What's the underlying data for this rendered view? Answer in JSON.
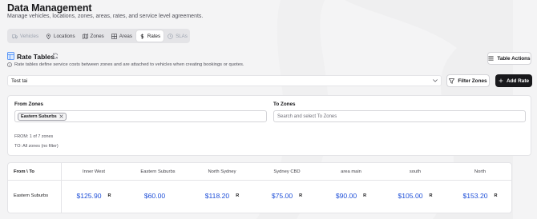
{
  "header": {
    "title": "Data Management",
    "subtitle": "Manage vehicles, locations, zones, areas, rates, and service level agreements."
  },
  "tabs": [
    {
      "label": "Vehicles",
      "icon": "truck-icon",
      "state": "muted"
    },
    {
      "label": "Locations",
      "icon": "map-pin-icon",
      "state": "normal"
    },
    {
      "label": "Zones",
      "icon": "map-icon",
      "state": "normal"
    },
    {
      "label": "Areas",
      "icon": "grid-icon",
      "state": "normal"
    },
    {
      "label": "Rates",
      "icon": "dollar-icon",
      "state": "active"
    },
    {
      "label": "SLAs",
      "icon": "clock-icon",
      "state": "muted"
    }
  ],
  "rate_tables": {
    "title": "Rate Tables",
    "description": "Rate tables define service costs between zones and are attached to vehicles when creating bookings or quotes.",
    "table_actions_label": "Table Actions",
    "selected_table": "Test tai",
    "filter_zones_label": "Filter Zones",
    "add_rate_label": "Add Rate"
  },
  "filters": {
    "from_label": "From Zones",
    "to_label": "To Zones",
    "from_chip": "Eastern Suburbs",
    "to_placeholder": "Search and select To Zones",
    "from_count": "FROM: 1 of 7 zones",
    "to_count": "TO: All zones (no filter)"
  },
  "rates_grid": {
    "corner": "From \\ To",
    "columns": [
      "Inner West",
      "Eastern Suburbs",
      "North Sydney",
      "Sydney CBD",
      "area main",
      "south",
      "North"
    ],
    "rows": [
      {
        "label": "Eastern Suburbs",
        "cells": [
          {
            "price": "$125.90",
            "badge": "R"
          },
          {
            "price": "$60.00",
            "badge": ""
          },
          {
            "price": "$118.20",
            "badge": "R"
          },
          {
            "price": "$75.00",
            "badge": "R"
          },
          {
            "price": "$90.00",
            "badge": "R"
          },
          {
            "price": "$105.00",
            "badge": "R"
          },
          {
            "price": "$153.20",
            "badge": "R"
          }
        ]
      }
    ]
  },
  "colors": {
    "accent_price": "#1d4ed8",
    "primary_button": "#18181b",
    "background": "#f4f4f5"
  }
}
